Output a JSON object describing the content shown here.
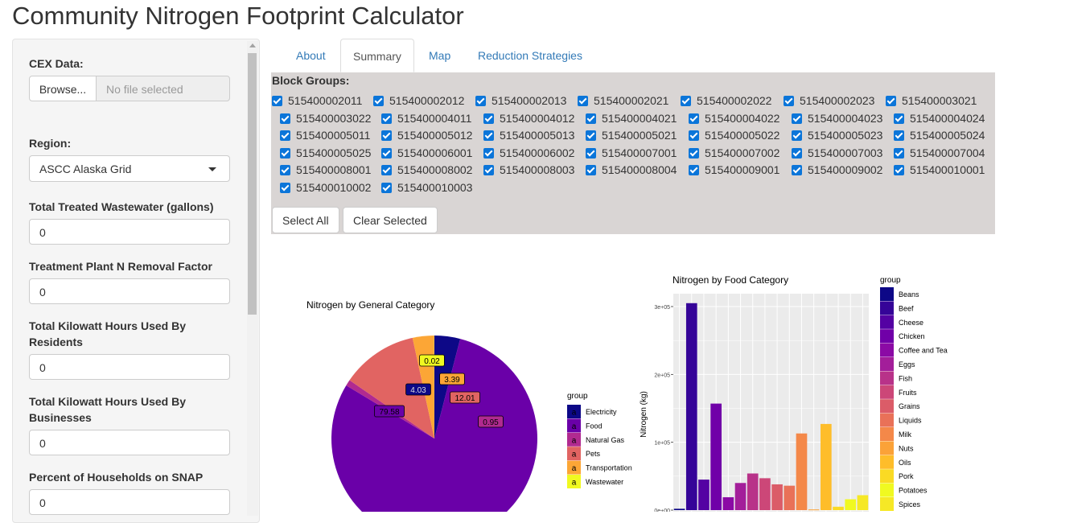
{
  "app_title": "Community Nitrogen Footprint Calculator",
  "sidebar": {
    "cex_label": "CEX Data:",
    "browse_label": "Browse...",
    "file_placeholder": "No file selected",
    "region_label": "Region:",
    "region_value": "ASCC Alaska Grid",
    "fields": [
      {
        "label": "Total Treated Wastewater (gallons)",
        "value": "0"
      },
      {
        "label": "Treatment Plant N Removal Factor",
        "value": "0"
      },
      {
        "label": "Total Kilowatt Hours Used By Residents",
        "value": "0"
      },
      {
        "label": "Total Kilowatt Hours Used By Businesses",
        "value": "0"
      },
      {
        "label": "Percent of Households on SNAP",
        "value": "0"
      }
    ]
  },
  "tabs": [
    {
      "label": "About",
      "active": false
    },
    {
      "label": "Summary",
      "active": true
    },
    {
      "label": "Map",
      "active": false
    },
    {
      "label": "Reduction Strategies",
      "active": false
    }
  ],
  "block_groups": {
    "title": "Block Groups:",
    "items": [
      "515400002011",
      "515400002012",
      "515400002013",
      "515400002021",
      "515400002022",
      "515400002023",
      "515400003021",
      "515400003022",
      "515400004011",
      "515400004012",
      "515400004021",
      "515400004022",
      "515400004023",
      "515400004024",
      "515400005011",
      "515400005012",
      "515400005013",
      "515400005021",
      "515400005022",
      "515400005023",
      "515400005024",
      "515400005025",
      "515400006001",
      "515400006002",
      "515400007001",
      "515400007002",
      "515400007003",
      "515400007004",
      "515400008001",
      "515400008002",
      "515400008003",
      "515400008004",
      "515400009001",
      "515400009002",
      "515400010001",
      "515400010002",
      "515400010003"
    ],
    "select_all_label": "Select All",
    "clear_label": "Clear Selected"
  },
  "chart_data": [
    {
      "type": "pie",
      "title": "Nitrogen by General Category",
      "legend_title": "group",
      "legend_placement": "right",
      "categories": [
        "Electricity",
        "Food",
        "Natural Gas",
        "Pets",
        "Transportation",
        "Wastewater"
      ],
      "values": [
        4.03,
        79.58,
        0.95,
        12.01,
        3.39,
        0.02
      ],
      "value_labels": [
        "4.03",
        "79.58",
        "0.95",
        "12.01",
        "3.39",
        "0.02"
      ],
      "colors": [
        "#0d0887",
        "#6a00a8",
        "#b12a90",
        "#e16462",
        "#fca636",
        "#f0f921"
      ],
      "legend_glyph": "a"
    },
    {
      "type": "bar",
      "title": "Nitrogen by Food Category",
      "ylabel": "Nitrogen (kg)",
      "xlabel": "",
      "legend_title": "group",
      "legend_placement": "right",
      "ylim": [
        0,
        305000
      ],
      "yticks": [
        "0e+00",
        "1e+05",
        "2e+05",
        "3e+05"
      ],
      "categories": [
        "Beans",
        "Beef",
        "Cheese",
        "Chicken",
        "Coffee and Tea",
        "Eggs",
        "Fish",
        "Fruits",
        "Grains",
        "Liquids",
        "Milk",
        "Nuts",
        "Oils",
        "Pork",
        "Potatoes",
        "Spices"
      ],
      "values": [
        2000,
        305000,
        45000,
        157000,
        19000,
        40000,
        54000,
        47000,
        38000,
        36000,
        113000,
        1000,
        127000,
        5000,
        16000,
        22000
      ],
      "colors": [
        "#0d0887",
        "#350498",
        "#5402a3",
        "#7000a8",
        "#8b0aa5",
        "#a31e9a",
        "#b83289",
        "#cc4778",
        "#db5c68",
        "#e97158",
        "#f48849",
        "#fba238",
        "#febd2a",
        "#fada24",
        "#f0f921",
        "#f6e826"
      ]
    }
  ]
}
